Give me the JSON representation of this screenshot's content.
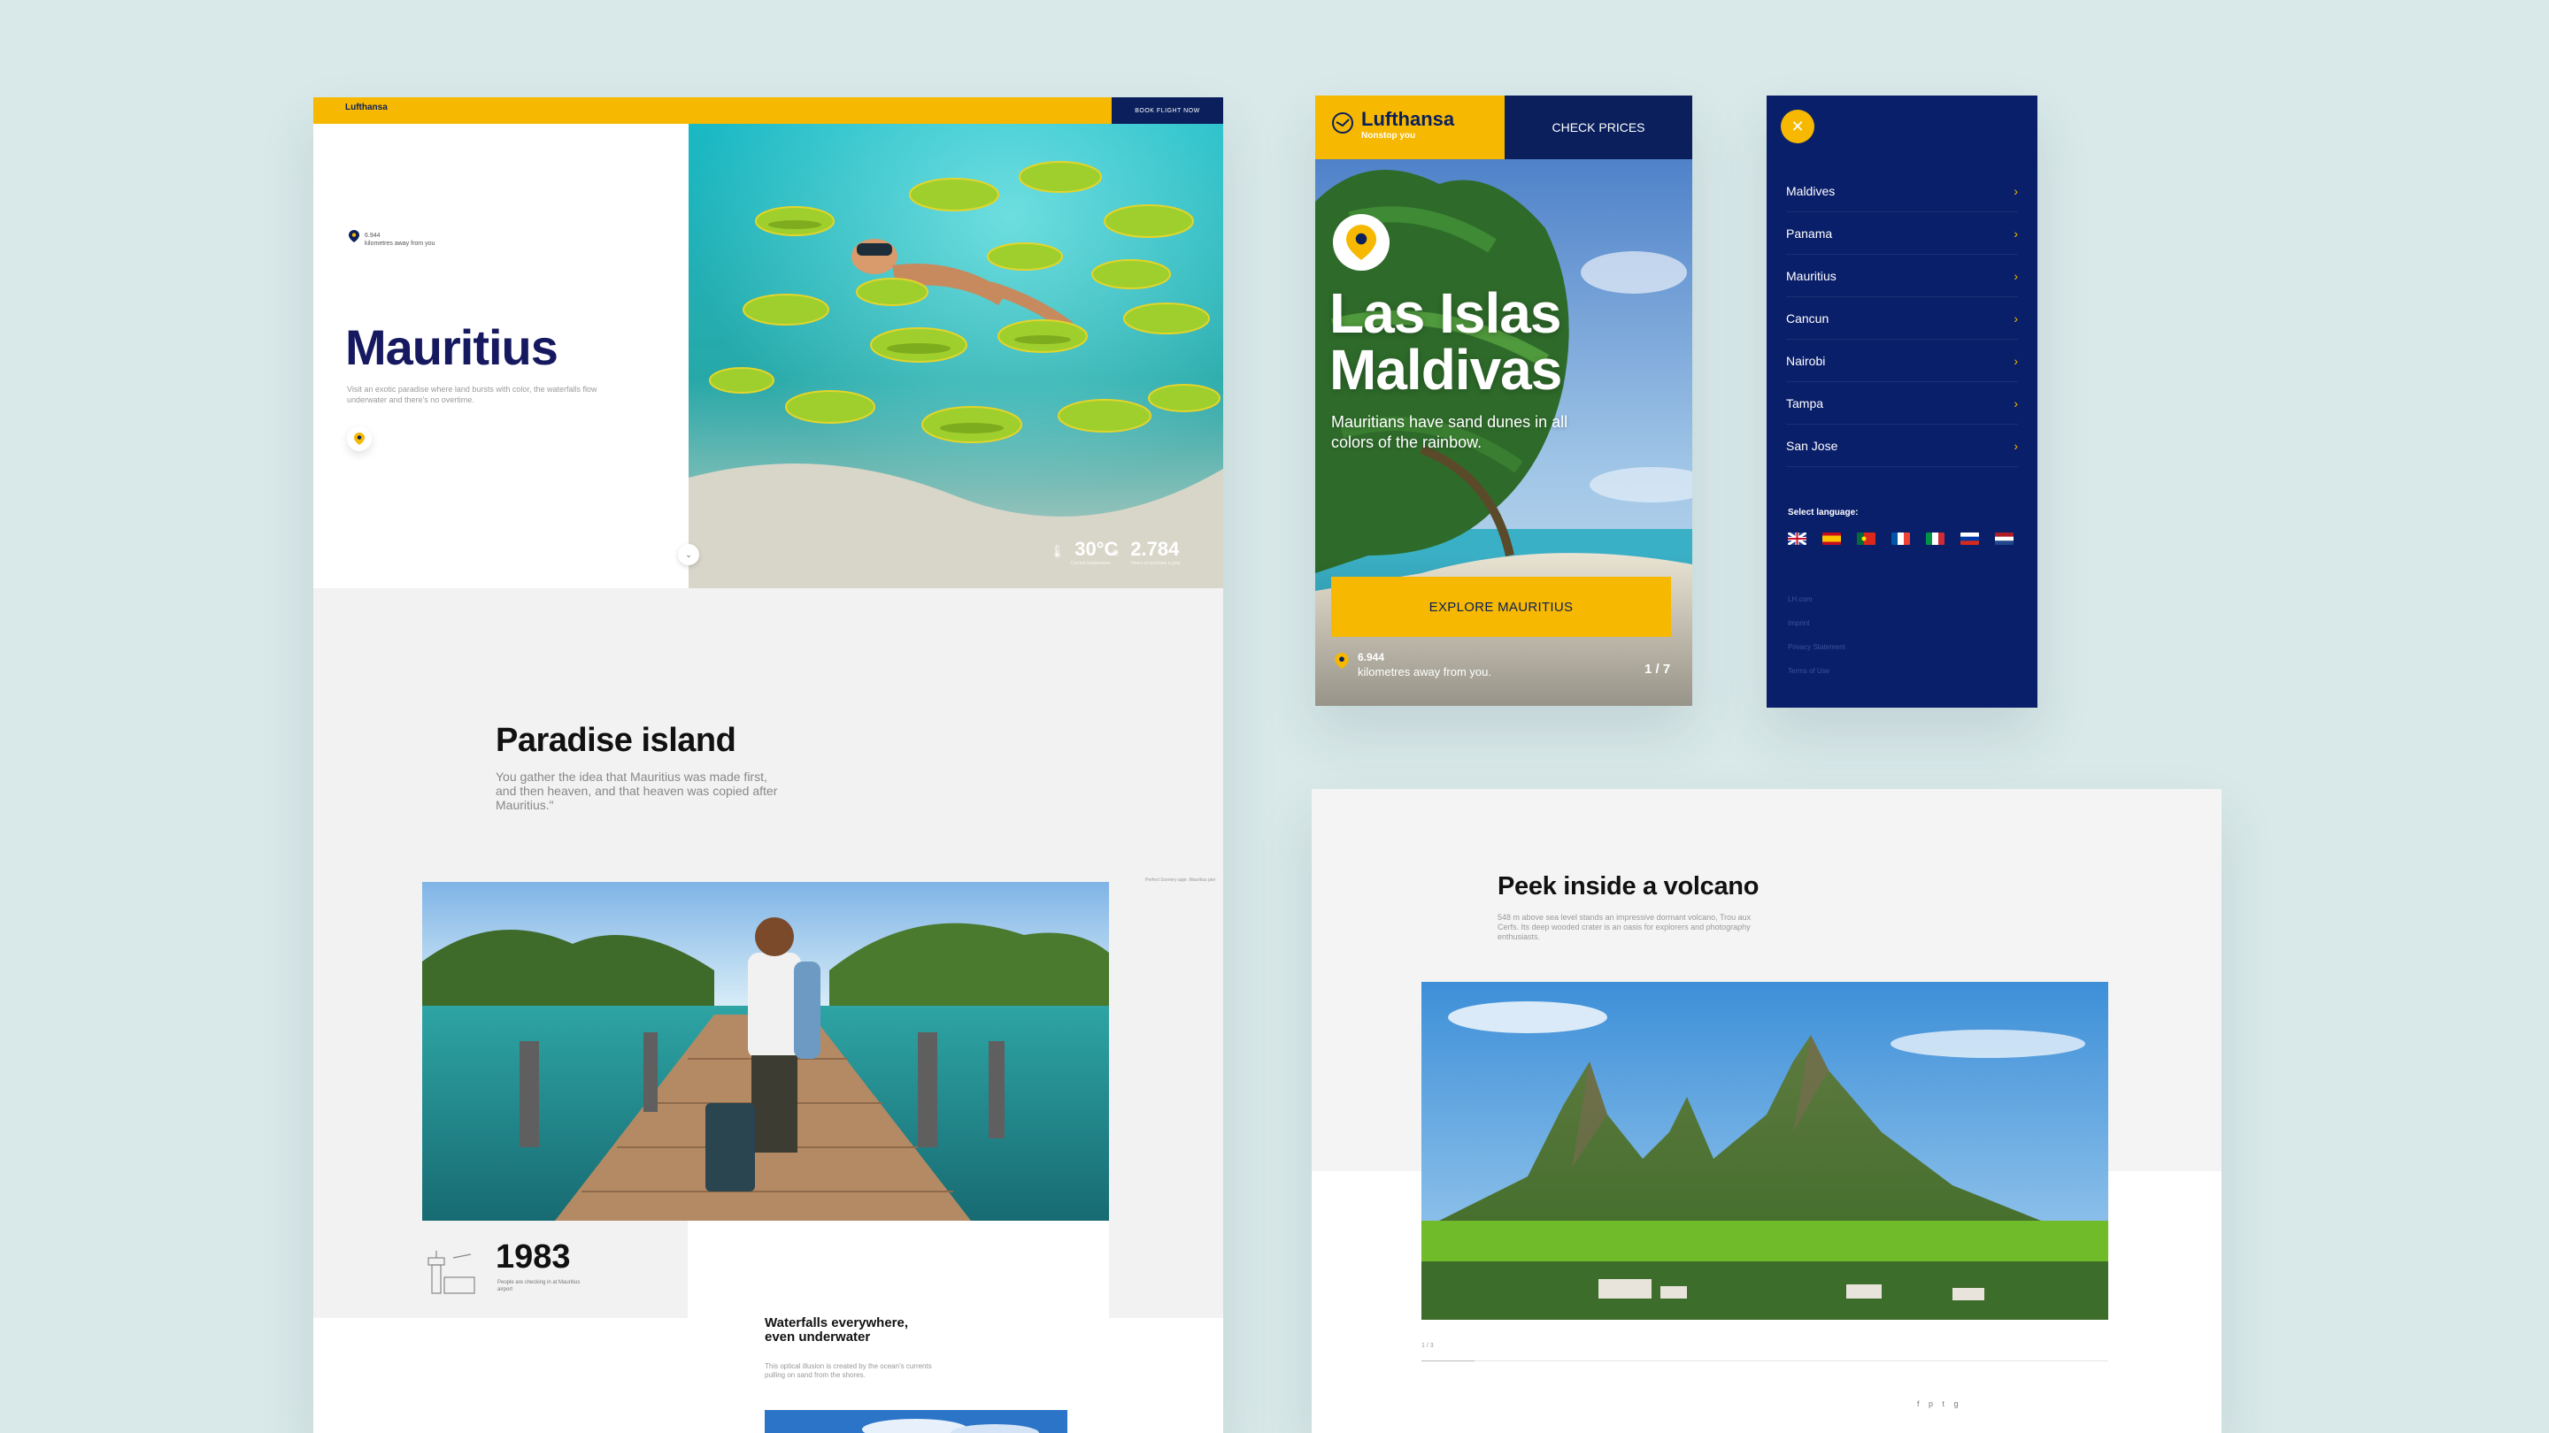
{
  "desktop": {
    "brand": "Lufthansa",
    "book_button": "BOOK FLIGHT NOW",
    "distance_value": "6.944",
    "distance_label": "kilometres away from you",
    "title": "Mauritius",
    "intro": "Visit an exotic paradise where land bursts with color, the waterfalls flow underwater and there's no overtime.",
    "temperature": "30°C",
    "temperature_label": "Current temperature",
    "sunshine": "2.784",
    "sunshine_label": "Hours of sunshine a year",
    "section_title": "Paradise island",
    "section_quote": "You gather the idea that Mauritius was made first, and then heaven, and that heaven was copied after Mauritius.\"",
    "caption": "Perfect Scenery appr. Mauritius pier",
    "year": "1983",
    "year_label": "People are checking in at Mauritius airport",
    "waterfalls_title": "Waterfalls everywhere, even underwater",
    "waterfalls_text": "This optical illusion is created by the ocean's currents pulling on sand from the shores."
  },
  "mobile_hero": {
    "brand": "Lufthansa",
    "tagline": "Nonstop you",
    "check_prices": "CHECK PRICES",
    "title_line1": "Las Islas",
    "title_line2": "Maldivas",
    "subtitle": "Mauritians have sand dunes in all colors of the rainbow.",
    "cta": "EXPLORE MAURITIUS",
    "distance_value": "6.944",
    "distance_label": "kilometres away from you.",
    "pager": "1 / 7"
  },
  "mobile_menu": {
    "close_icon": "✕",
    "items": [
      "Maldives",
      "Panama",
      "Mauritius",
      "Cancun",
      "Nairobi",
      "Tampa",
      "San Jose"
    ],
    "language_label": "Select language:",
    "links": [
      "LH.com",
      "Imprint",
      "Privacy Statement",
      "Terms of Use"
    ]
  },
  "volcano": {
    "title": "Peek inside a volcano",
    "text": "548 m above sea level stands an impressive dormant volcano, Trou aux Cerfs. Its deep wooded crater is an oasis for explorers and photography enthusiasts.",
    "pager": "1 / 3",
    "share": "f p t g"
  }
}
